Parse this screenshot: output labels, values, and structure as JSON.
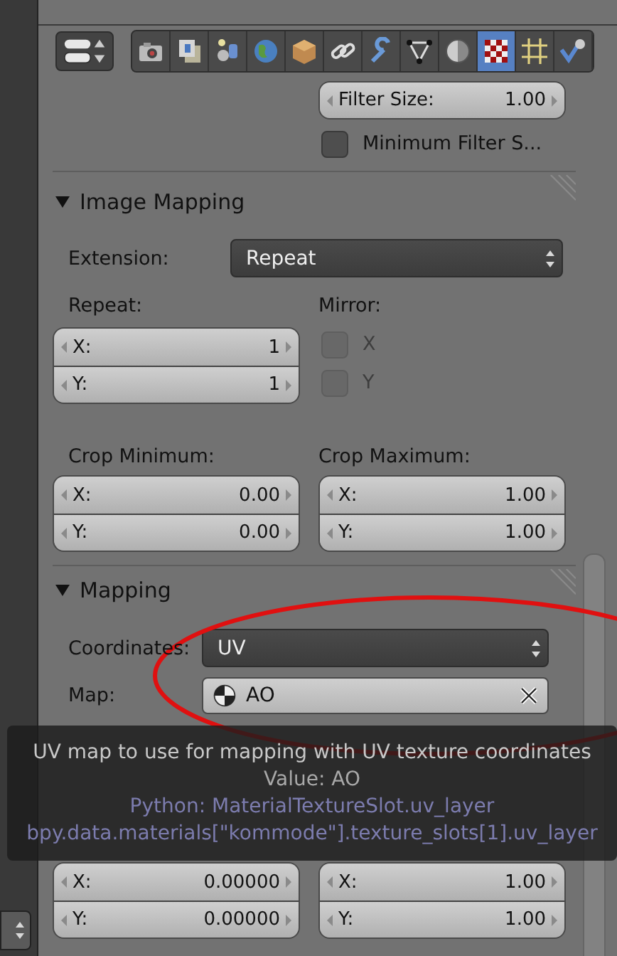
{
  "tabs": [
    {
      "selected": false
    },
    {
      "selected": false
    },
    {
      "selected": false
    },
    {
      "selected": false
    },
    {
      "selected": false
    },
    {
      "selected": false
    },
    {
      "selected": false
    },
    {
      "selected": false
    },
    {
      "selected": false
    },
    {
      "selected": true
    },
    {
      "selected": false
    },
    {
      "selected": false
    }
  ],
  "filter": {
    "filter_size": {
      "label": "Filter Size:",
      "value": "1.00"
    },
    "minimum_filter_size": {
      "label": "Minimum Filter S...",
      "checked": false
    }
  },
  "image_mapping": {
    "title": "Image Mapping",
    "expanded": true,
    "extension": {
      "label": "Extension:",
      "value": "Repeat"
    },
    "repeat": {
      "label": "Repeat:",
      "fields": [
        {
          "label": "X:",
          "value": "1"
        },
        {
          "label": "Y:",
          "value": "1"
        }
      ]
    },
    "mirror": {
      "label": "Mirror:",
      "options": [
        {
          "label": "X",
          "checked": false,
          "disabled": true
        },
        {
          "label": "Y",
          "checked": false,
          "disabled": true
        }
      ]
    },
    "crop_minimum": {
      "label": "Crop Minimum:",
      "fields": [
        {
          "label": "X:",
          "value": "0.00"
        },
        {
          "label": "Y:",
          "value": "0.00"
        }
      ]
    },
    "crop_maximum": {
      "label": "Crop Maximum:",
      "fields": [
        {
          "label": "X:",
          "value": "1.00"
        },
        {
          "label": "Y:",
          "value": "1.00"
        }
      ]
    }
  },
  "mapping": {
    "title": "Mapping",
    "expanded": true,
    "coordinates": {
      "label": "Coordinates:",
      "value": "UV"
    },
    "map": {
      "label": "Map:",
      "value": "AO"
    },
    "offset": [
      {
        "label": "X:",
        "value": "0.00000"
      },
      {
        "label": "Y:",
        "value": "0.00000"
      }
    ],
    "size": [
      {
        "label": "X:",
        "value": "1.00"
      },
      {
        "label": "Y:",
        "value": "1.00"
      }
    ]
  },
  "tooltip": {
    "description": "UV map to use for mapping with UV texture coordinates",
    "value": "Value: AO",
    "python": "Python: MaterialTextureSlot.uv_layer",
    "path": "bpy.data.materials[\"kommode\"].texture_slots[1].uv_layer"
  }
}
